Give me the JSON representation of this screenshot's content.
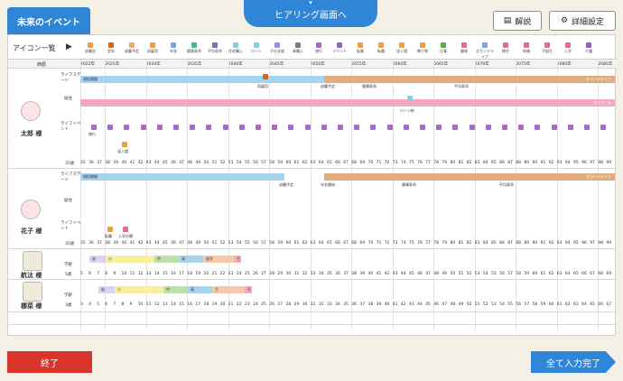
{
  "header": {
    "left_tab": "未来のイベント",
    "center_tab": "ヒアリング画面へ",
    "guide_button": "解説",
    "settings_button": "詳細設定"
  },
  "icon_list": {
    "label": "アイコン一覧",
    "items": [
      "退職金",
      "定年",
      "退職予定",
      "再雇用",
      "年金",
      "健康寿命",
      "平均寿命",
      "住宅購入",
      "ローン",
      "子の支援",
      "車購入",
      "旅行",
      "イベント",
      "起業",
      "転職",
      "収入増",
      "贈り物",
      "仕事",
      "趣味",
      "セカンドライフ",
      "移住",
      "結婚",
      "子誕生",
      "入学",
      "介護"
    ]
  },
  "timeline": {
    "age_header": "西暦",
    "year_labels": [
      "2022年",
      "2025年",
      "2030年",
      "2035年",
      "2040年",
      "2045年",
      "2050年",
      "2055年",
      "2060年",
      "2065年",
      "2070年",
      "2075年",
      "2080年",
      "2085年"
    ]
  },
  "persons": [
    {
      "name": "太郎 様",
      "rows": [
        "ライフステージ",
        "居住",
        "ライフイベント"
      ],
      "age_label": "35歳",
      "ages": [
        "35",
        "36",
        "37",
        "38",
        "39",
        "40",
        "41",
        "42",
        "43",
        "44",
        "45",
        "46",
        "47",
        "48",
        "49",
        "50",
        "51",
        "52",
        "53",
        "54",
        "55",
        "56",
        "57",
        "58",
        "59",
        "60",
        "61",
        "62",
        "63",
        "64",
        "65",
        "66",
        "67",
        "68",
        "69",
        "70",
        "71",
        "72",
        "73",
        "74",
        "75",
        "76",
        "77",
        "78",
        "79",
        "80",
        "81",
        "82",
        "83",
        "84",
        "85",
        "86",
        "87",
        "88",
        "89",
        "90",
        "91",
        "92",
        "93",
        "94",
        "95",
        "96",
        "97",
        "98",
        "99"
      ],
      "stage_labels": {
        "work": "現役期間",
        "retire_plan": "退職予定",
        "second": "セカンドライフ",
        "reemploy": "再雇用",
        "pension": "年金受給",
        "healthy": "健康寿命",
        "avglife": "平均寿命"
      },
      "housing_labels": {
        "myhome": "マイホーム",
        "loan": "ローン終"
      },
      "event_labels": {
        "trip": "旅行",
        "raise": "収入増"
      }
    },
    {
      "name": "花子 様",
      "rows": [
        "ライフステージ",
        "居住",
        "ライフイベント"
      ],
      "age_label": "35歳",
      "ages": [
        "35",
        "36",
        "37",
        "38",
        "39",
        "40",
        "41",
        "42",
        "43",
        "44",
        "45",
        "46",
        "47",
        "48",
        "49",
        "50",
        "51",
        "52",
        "53",
        "54",
        "55",
        "56",
        "57",
        "58",
        "59",
        "60",
        "61",
        "62",
        "63",
        "64",
        "65",
        "66",
        "67",
        "68",
        "69",
        "70",
        "71",
        "72",
        "73",
        "74",
        "75",
        "76",
        "77",
        "78",
        "79",
        "80",
        "81",
        "82",
        "83",
        "84",
        "85",
        "86",
        "87",
        "88",
        "89",
        "90",
        "91",
        "92",
        "93",
        "94",
        "95",
        "96",
        "97",
        "98",
        "99"
      ],
      "stage_labels": {
        "work": "現役期間",
        "retire_plan": "退職予定",
        "pension": "年金開始",
        "healthy": "健康寿命",
        "avglife": "平均寿命",
        "second": "セカンドライフ"
      },
      "event_labels": {
        "job": "転職",
        "raise": "入学の贈"
      }
    },
    {
      "name": "航汰 様",
      "rows": [
        "学齢",
        "5歳"
      ],
      "age_label": "5歳",
      "ages": [
        "5",
        "6",
        "7",
        "8",
        "9",
        "10",
        "11",
        "12",
        "13",
        "14",
        "15",
        "16",
        "17",
        "18",
        "19",
        "20",
        "21",
        "22",
        "23",
        "24",
        "25",
        "26",
        "27",
        "28",
        "29",
        "30",
        "31",
        "32",
        "33",
        "34",
        "35",
        "36",
        "37",
        "38",
        "39",
        "40",
        "41",
        "42",
        "43",
        "44",
        "45",
        "46",
        "47",
        "48",
        "49",
        "50",
        "51",
        "52",
        "53",
        "54",
        "55",
        "56",
        "57",
        "58",
        "59",
        "60",
        "61",
        "62",
        "63",
        "64",
        "65",
        "66",
        "67",
        "68",
        "69"
      ],
      "school": [
        "幼",
        "小",
        "中",
        "高",
        "留学",
        "その他"
      ]
    },
    {
      "name": "梛菜 様",
      "rows": [
        "学齢",
        "3歳"
      ],
      "age_label": "3歳",
      "ages": [
        "3",
        "4",
        "5",
        "6",
        "7",
        "8",
        "9",
        "10",
        "11",
        "12",
        "13",
        "14",
        "15",
        "16",
        "17",
        "18",
        "19",
        "20",
        "21",
        "22",
        "23",
        "24",
        "25",
        "26",
        "27",
        "28",
        "29",
        "30",
        "31",
        "32",
        "33",
        "34",
        "35",
        "36",
        "37",
        "38",
        "39",
        "40",
        "41",
        "42",
        "43",
        "44",
        "45",
        "46",
        "47",
        "48",
        "49",
        "50",
        "51",
        "52",
        "53",
        "54",
        "55",
        "56",
        "57",
        "58",
        "59",
        "60",
        "61",
        "62",
        "63",
        "64",
        "65",
        "66",
        "67"
      ],
      "school": [
        "幼",
        "小",
        "中",
        "高",
        "大",
        "その他"
      ]
    }
  ],
  "footer": {
    "end_button": "終了",
    "complete_button": "全て入力完了"
  },
  "colors": {
    "blue": "#2f86d6",
    "red": "#d9342b",
    "stage_blue": "#a8d3ef",
    "stage_orange": "#e0ad7e",
    "housing_pink": "#f2a9bf"
  }
}
